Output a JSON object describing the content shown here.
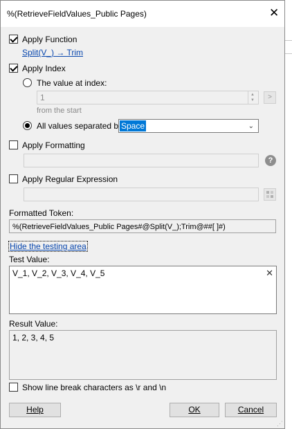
{
  "dialog": {
    "title": "%(RetrieveFieldValues_Public Pages)",
    "close_glyph": "✕"
  },
  "apply_function": {
    "checked": true,
    "label": "Apply Function",
    "link_text": "Split(V_) → Trim"
  },
  "apply_index": {
    "checked": true,
    "label": "Apply Index",
    "value_at_index_label": "The value at index:",
    "index_value": "1",
    "from_label": "from the  start",
    "arrow_button": ">",
    "all_values_label": "All values separated by:",
    "separator_selected": "Space",
    "selected_option": "all_values"
  },
  "apply_formatting": {
    "checked": false,
    "label": "Apply Formatting",
    "value": "",
    "help_glyph": "?"
  },
  "apply_regex": {
    "checked": false,
    "label": "Apply Regular Expression",
    "value": ""
  },
  "formatted_token": {
    "label": "Formatted Token:",
    "value": "%(RetrieveFieldValues_Public Pages#@Split(V_);Trim@##[ ]#)"
  },
  "testing": {
    "hide_link": "Hide the testing area",
    "test_value_label": "Test Value:",
    "test_value": "V_1, V_2, V_3, V_4, V_5",
    "clear_glyph": "✕",
    "result_label": "Result Value:",
    "result_value": "1, 2, 3, 4, 5",
    "show_linebreaks_label": "Show line break characters as \\r and \\n",
    "show_linebreaks_checked": false
  },
  "buttons": {
    "help": "Help",
    "ok": "OK",
    "cancel": "Cancel"
  }
}
